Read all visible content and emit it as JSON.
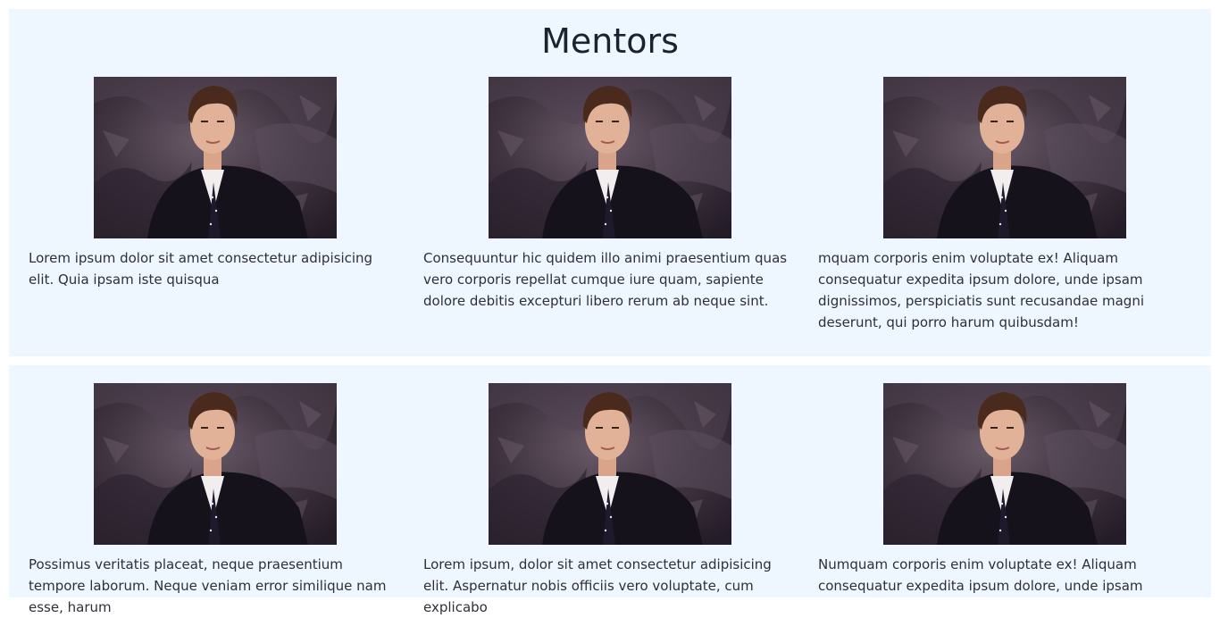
{
  "sections": [
    {
      "title": "Mentors",
      "mentors": [
        {
          "photo": "mentor-portrait",
          "text": "Lorem ipsum dolor sit amet consectetur adipisicing elit. Quia ipsam iste quisqua"
        },
        {
          "photo": "mentor-portrait",
          "text": "Consequuntur hic quidem illo animi praesentium quas vero corporis repellat cumque iure quam, sapiente dolore debitis excepturi libero rerum ab neque sint."
        },
        {
          "photo": "mentor-portrait",
          "text": "mquam corporis enim voluptate ex! Aliquam consequatur expedita ipsum dolore, unde ipsam dignissimos, perspiciatis sunt recusandae magni deserunt, qui porro harum quibusdam!"
        }
      ]
    },
    {
      "title": "",
      "mentors": [
        {
          "photo": "mentor-portrait",
          "text": "Possimus veritatis placeat, neque praesentium tempore laborum. Neque veniam error similique nam esse, harum"
        },
        {
          "photo": "mentor-portrait",
          "text": "Lorem ipsum, dolor sit amet consectetur adipisicing elit. Aspernatur nobis officiis vero voluptate, cum explicabo"
        },
        {
          "photo": "mentor-portrait",
          "text": "Numquam corporis enim voluptate ex! Aliquam consequatur expedita ipsum dolore, unde ipsam"
        }
      ]
    }
  ],
  "colors": {
    "section_background": "#eef6ff",
    "title_text": "#1d2230",
    "body_text": "#2f2f38"
  }
}
